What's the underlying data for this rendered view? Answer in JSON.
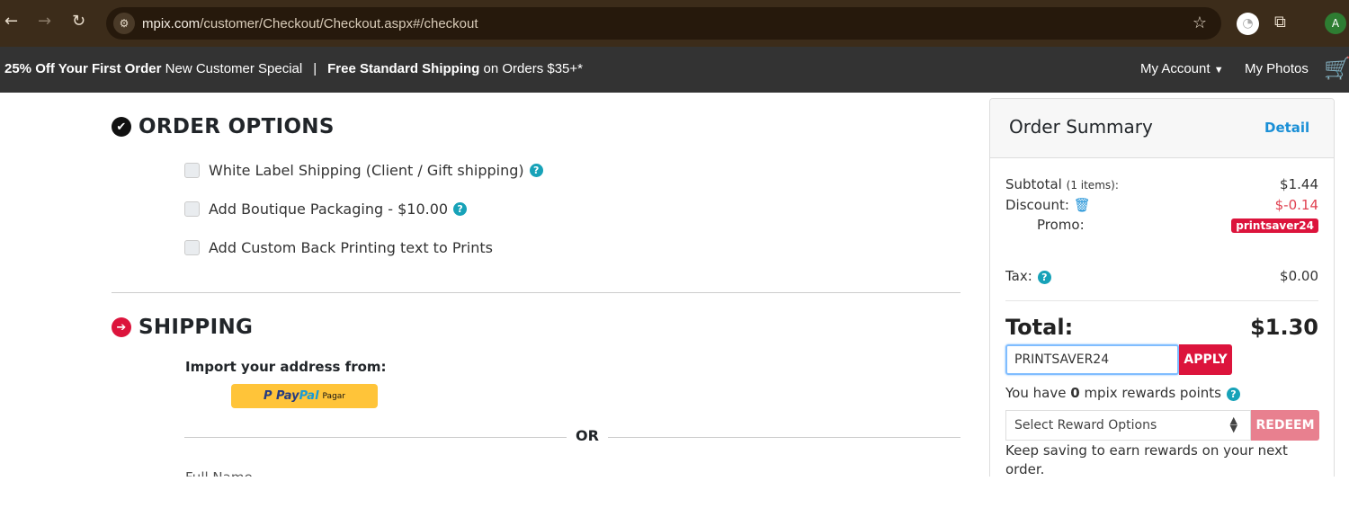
{
  "browser": {
    "url_domain": "mpix.com",
    "url_path": "/customer/Checkout/Checkout.aspx#/checkout",
    "profile_initial": "A"
  },
  "promo_bar": {
    "offer_bold": "25% Off Your First Order",
    "offer_rest": "New Customer Special",
    "separator": "|",
    "shipping_bold": "Free Standard Shipping",
    "shipping_rest": "on Orders $35+*",
    "my_account": "My Account",
    "my_photos": "My Photos"
  },
  "order_options": {
    "title": "ORDER OPTIONS",
    "options": [
      {
        "label": "White Label Shipping (Client / Gift shipping)",
        "checked": false,
        "help": true
      },
      {
        "label": "Add Boutique Packaging - $10.00",
        "checked": false,
        "help": true
      },
      {
        "label": "Add Custom Back Printing text to Prints",
        "checked": false,
        "help": false
      }
    ]
  },
  "shipping": {
    "title": "SHIPPING",
    "import_label": "Import your address from:",
    "paypal_pay": "Pay",
    "paypal_pal": "Pal",
    "paypal_action": "Pagar",
    "or": "OR",
    "full_name_label": "Full Name"
  },
  "summary": {
    "title": "Order Summary",
    "detail_link": "Detail",
    "subtotal_label": "Subtotal",
    "subtotal_items": "(1 items):",
    "subtotal": "$1.44",
    "discount_label": "Discount:",
    "discount": "$-0.14",
    "promo_label": "Promo:",
    "promo_code": "printsaver24",
    "tax_label": "Tax:",
    "tax": "$0.00",
    "total_label": "Total:",
    "total": "$1.30",
    "promo_input_value": "PRINTSAVER24",
    "apply": "APPLY",
    "rewards_pre": "You have",
    "rewards_points": "0",
    "rewards_post": "mpix rewards points",
    "reward_select": "Select Reward Options",
    "redeem": "REDEEM",
    "rewards_note": "Keep saving to earn rewards on your next order."
  },
  "colors": {
    "accent": "#dc143c",
    "link": "#1a8fd6",
    "help": "#17a2b8",
    "promo_bar": "#333333"
  }
}
